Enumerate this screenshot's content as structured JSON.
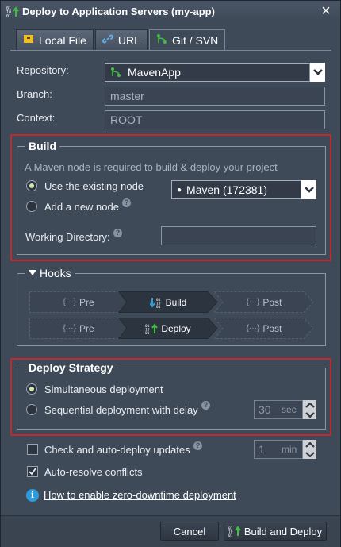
{
  "window": {
    "title": "Deploy to Application Servers (my-app)"
  },
  "tabs": [
    {
      "label": "Local File",
      "icon": "archive-icon"
    },
    {
      "label": "URL",
      "icon": "link-icon"
    },
    {
      "label": "Git / SVN",
      "icon": "git-icon",
      "active": true
    }
  ],
  "source": {
    "repository_label": "Repository:",
    "repository_value": "MavenApp",
    "branch_label": "Branch:",
    "branch_value": "master",
    "context_label": "Context:",
    "context_value": "ROOT"
  },
  "build": {
    "title": "Build",
    "hint": "A Maven node is required to build & deploy your project",
    "option_existing": "Use the existing node",
    "option_new": "Add a new node",
    "selected": "existing",
    "node_value": "Maven (172381)",
    "workdir_label": "Working Directory:",
    "workdir_value": ""
  },
  "hooks": {
    "title": "Hooks",
    "build_row": {
      "pre": "Pre",
      "main": "Build",
      "post": "Post"
    },
    "deploy_row": {
      "pre": "Pre",
      "main": "Deploy",
      "post": "Post"
    }
  },
  "strategy": {
    "title": "Deploy Strategy",
    "option_simultaneous": "Simultaneous deployment",
    "option_sequential": "Sequential deployment with delay",
    "selected": "simultaneous",
    "delay_value": "30",
    "delay_unit": "sec"
  },
  "options": {
    "auto_update_label": "Check and auto-deploy updates",
    "auto_update_checked": false,
    "interval_value": "1",
    "interval_unit": "min",
    "auto_resolve_label": "Auto-resolve conflicts",
    "auto_resolve_checked": true,
    "help_link": "How to enable zero-downtime deployment"
  },
  "footer": {
    "cancel_label": "Cancel",
    "deploy_label": "Build and Deploy"
  },
  "colors": {
    "highlight_border": "#c4282d",
    "accent_green": "#3fbf3f",
    "info_blue": "#2e9bdc"
  }
}
